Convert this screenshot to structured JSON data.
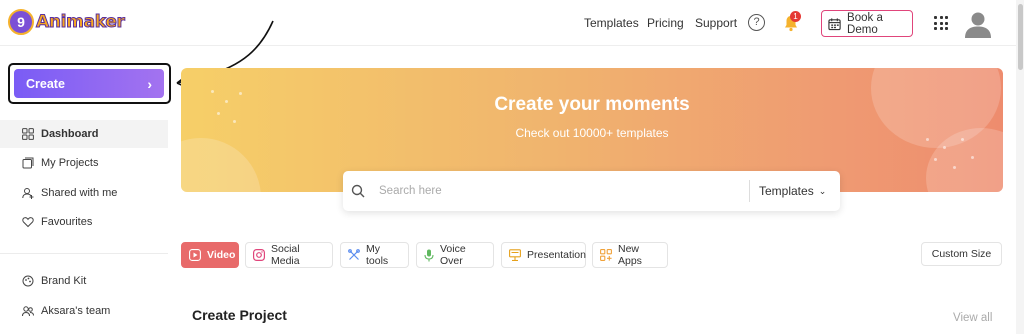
{
  "app": {
    "logo_text": "Animaker",
    "logo_mascot_letter": "9"
  },
  "nav": {
    "templates": "Templates",
    "pricing": "Pricing",
    "support": "Support",
    "help_glyph": "?",
    "notification_count": "1",
    "book_demo": "Book a Demo"
  },
  "sidebar": {
    "create_label": "Create",
    "create_chevron": "›",
    "items": [
      {
        "label": "Dashboard",
        "icon": "dashboard-icon",
        "active": true
      },
      {
        "label": "My Projects",
        "icon": "projects-icon"
      },
      {
        "label": "Shared with me",
        "icon": "shared-icon"
      },
      {
        "label": "Favourites",
        "icon": "heart-icon"
      },
      {
        "label": "Brand Kit",
        "icon": "brand-kit-icon"
      },
      {
        "label": "Aksara's team",
        "icon": "team-icon"
      }
    ]
  },
  "banner": {
    "title": "Create your moments",
    "subtitle": "Check out 10000+ templates"
  },
  "search": {
    "placeholder": "Search here",
    "dropdown_value": "Templates",
    "dropdown_caret": "⌄"
  },
  "categories": [
    {
      "label": "Video",
      "icon": "video-icon",
      "active": true
    },
    {
      "label": "Social Media",
      "icon": "instagram-icon"
    },
    {
      "label": "My tools",
      "icon": "tools-icon"
    },
    {
      "label": "Voice Over",
      "icon": "mic-icon"
    },
    {
      "label": "Presentation",
      "icon": "presentation-icon"
    },
    {
      "label": "New Apps",
      "icon": "apps-icon"
    }
  ],
  "custom_size": "Custom Size",
  "section": {
    "title": "Create Project",
    "view_all": "View all"
  },
  "colors": {
    "accent_purple": "#7a5cf5",
    "video_tab": "#e86a6a",
    "demo_border": "#e0457b",
    "logo_orange": "#f5a623"
  }
}
